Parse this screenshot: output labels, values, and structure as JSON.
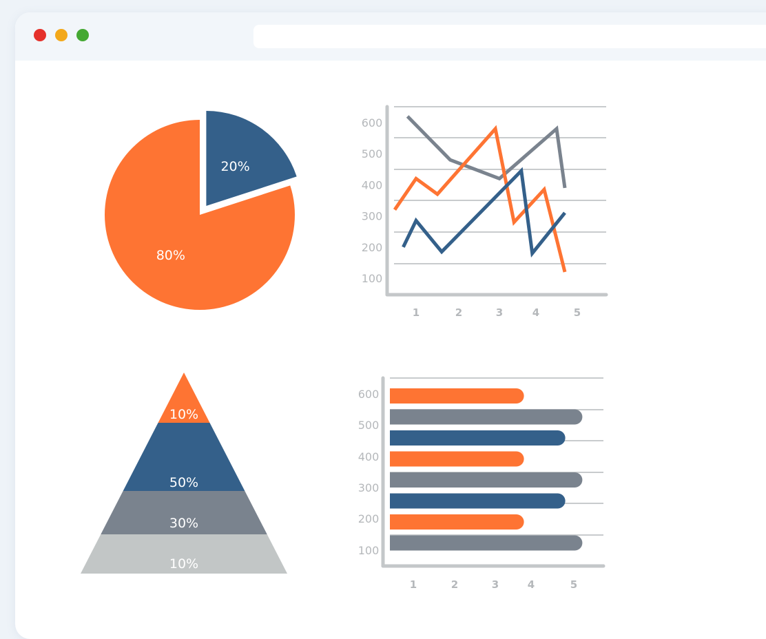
{
  "colors": {
    "orange": "#fe7433",
    "blue": "#34608a",
    "gray": "#7a838e",
    "light_gray": "#c2c6c6",
    "grid": "#c8cbcd",
    "axis": "#c4c7c9"
  },
  "icons": [
    "close-dot",
    "minimize-dot",
    "maximize-dot"
  ],
  "chart_data": [
    {
      "type": "pie",
      "slices": [
        {
          "label": "20%",
          "value": 20,
          "color": "#34608a",
          "exploded": true
        },
        {
          "label": "80%",
          "value": 80,
          "color": "#fe7433",
          "exploded": false
        }
      ]
    },
    {
      "type": "line",
      "y_ticks": [
        "600",
        "500",
        "400",
        "300",
        "200",
        "100"
      ],
      "x_ticks": [
        "1",
        "2",
        "3",
        "4",
        "5"
      ],
      "ylim": [
        100,
        600
      ],
      "grid": true,
      "series": [
        {
          "color": "#7a838e",
          "points": [
            [
              0.8,
              620
            ],
            [
              1.8,
              480
            ],
            [
              3.0,
              420
            ],
            [
              4.5,
              580
            ],
            [
              4.7,
              390
            ]
          ]
        },
        {
          "color": "#fe7433",
          "points": [
            [
              0.5,
              320
            ],
            [
              1.0,
              420
            ],
            [
              1.5,
              370
            ],
            [
              2.9,
              580
            ],
            [
              3.4,
              280
            ],
            [
              4.2,
              385
            ],
            [
              4.7,
              120
            ]
          ]
        },
        {
          "color": "#34608a",
          "points": [
            [
              0.7,
              200
            ],
            [
              1.0,
              285
            ],
            [
              1.6,
              185
            ],
            [
              3.6,
              445
            ],
            [
              3.9,
              180
            ],
            [
              4.7,
              310
            ]
          ]
        }
      ]
    },
    {
      "type": "pyramid",
      "levels": [
        {
          "label": "10%",
          "color": "#fe7433"
        },
        {
          "label": "50%",
          "color": "#34608a"
        },
        {
          "label": "30%",
          "color": "#7a838e"
        },
        {
          "label": "10%",
          "color": "#c2c6c6"
        }
      ]
    },
    {
      "type": "bar",
      "orientation": "horizontal",
      "y_ticks": [
        "600",
        "500",
        "400",
        "300",
        "200",
        "100"
      ],
      "x_ticks": [
        "1",
        "2",
        "3",
        "4",
        "5"
      ],
      "grid": true,
      "bars": [
        {
          "value": 3.8,
          "color": "#fe7433"
        },
        {
          "value": 5.2,
          "color": "#7a838e"
        },
        {
          "value": 4.8,
          "color": "#34608a"
        },
        {
          "value": 3.8,
          "color": "#fe7433"
        },
        {
          "value": 5.2,
          "color": "#7a838e"
        },
        {
          "value": 4.8,
          "color": "#34608a"
        },
        {
          "value": 3.8,
          "color": "#fe7433"
        },
        {
          "value": 5.2,
          "color": "#7a838e"
        }
      ]
    }
  ]
}
